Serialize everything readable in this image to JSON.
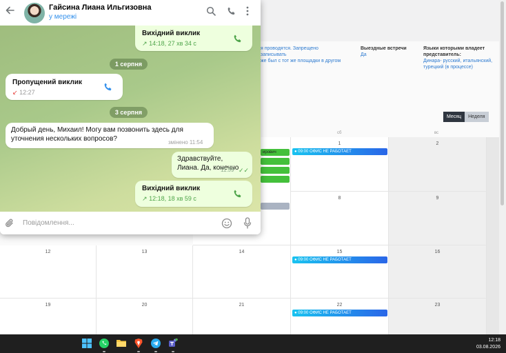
{
  "telegram": {
    "contact_name": "Гайсина Лиана Ильгизовна",
    "status": "у мережі",
    "messages": [
      {
        "title": "Вихідний виклик",
        "sub": "14:18, 27 хв 34 с"
      },
      {
        "date": "1 серпня"
      },
      {
        "title": "Пропущений виклик",
        "sub": "12:27"
      },
      {
        "date": "3 серпня"
      },
      {
        "text": "Добрый день, Михаил! Могу вам позвонить здесь для уточнения нескольких вопросов?",
        "meta": "змінено 11:54"
      },
      {
        "text": "Здравствуйте, Лиана. Да, конечно",
        "meta": "11:59"
      },
      {
        "title": "Вихідний виклик",
        "sub": "12:18, 18 хв 59 с"
      }
    ],
    "composer_placeholder": "Повідомлення..."
  },
  "webpage": {
    "info": [
      {
        "label": "",
        "value": "я проводятся. Запрещено записывать"
      },
      {
        "label": "",
        "value": "же был с тот же площадки в другом"
      },
      {
        "label": "Выездные встречи",
        "value": "Да"
      },
      {
        "label": "Языки которыми владеет представитель:",
        "value": "Динара- русский, итальянский, турецкий (в процессе)"
      }
    ],
    "view_toggle": {
      "month": "Месяц",
      "week": "Неделя"
    },
    "day_headers": [
      "сб",
      "вс"
    ],
    "calendar": {
      "row1": [
        "",
        "",
        "",
        "1",
        "2"
      ],
      "row2": [
        "",
        "",
        "",
        "8",
        "9"
      ],
      "row3": [
        "12",
        "13",
        "14",
        "15",
        "16"
      ],
      "row4": [
        "19",
        "20",
        "21",
        "22",
        "23"
      ],
      "partial_event": "ирович",
      "office_event": "09:00 ОФИС НЕ РАБОТАЕТ"
    }
  },
  "taskbar": {
    "time": "12:18",
    "date": "03.08.2026"
  }
}
